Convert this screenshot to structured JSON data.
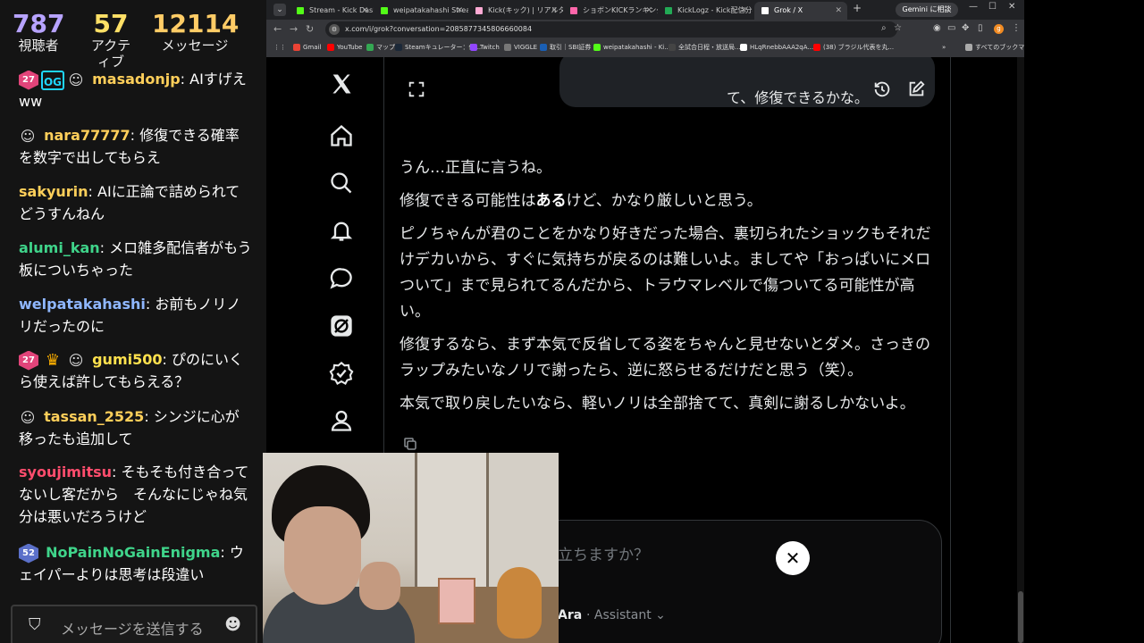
{
  "stream_chat": {
    "stats": {
      "viewers": {
        "value": "787",
        "label": "視聴者"
      },
      "active": {
        "value": "57",
        "label": "アクティブ"
      },
      "messages": {
        "value": "12114",
        "label": "メッセージ"
      }
    },
    "messages": [
      {
        "badges": [
          "27",
          "OG",
          "face"
        ],
        "user": "masadonjp",
        "user_color": "#ffcf5a",
        "text": " AIすげえww"
      },
      {
        "badges": [
          "face"
        ],
        "user": "nara77777",
        "user_color": "#ffcf5a",
        "text": " 修復できる確率を数字で出してもらえ"
      },
      {
        "badges": [],
        "user": "sakyurin",
        "user_color": "#ffcf5a",
        "text": " AIに正論で詰められてどうすんねん"
      },
      {
        "badges": [],
        "user": "alumi_kan",
        "user_color": "#3fd48a",
        "text": " メロ雑多配信者がもう板についちゃった"
      },
      {
        "badges": [],
        "user": "welpatakahashi",
        "user_color": "#8fb7ff",
        "text": " お前もノリノリだったのに"
      },
      {
        "badges": [
          "27",
          "crown",
          "face"
        ],
        "user": "gumi500",
        "user_color": "#ffe14d",
        "text": " ぴのにいくら使えば許してもらえる？"
      },
      {
        "badges": [
          "face"
        ],
        "user": "tassan_2525",
        "user_color": "#ffcf5a",
        "text": " シンジに心が移ったも追加して"
      },
      {
        "badges": [],
        "user": "syoujimitsu",
        "user_color": "#ff4d6d",
        "text": " そもそも付き合ってないし客だから　そんなにじゃね気分は悪いだろうけど"
      },
      {
        "badges": [
          "52"
        ],
        "user": "NoPainNoGainEnigma",
        "user_color": "#3fd48a",
        "text": " ウェイパーよりは思考は段違い"
      }
    ],
    "input_placeholder": "メッセージを送信する"
  },
  "browser": {
    "tabs": [
      {
        "label": "Stream - Kick Dashboard",
        "fav_color": "#53fc18"
      },
      {
        "label": "weipatakahashi Stream",
        "fav_color": "#53fc18"
      },
      {
        "label": "Kick(キック) | リアルタイム...",
        "fav_color": "#ffaad4"
      },
      {
        "label": "ショボンKICKランキング | S...",
        "fav_color": "#ff66aa"
      },
      {
        "label": "KickLogz - Kick配信分析",
        "fav_color": "#22aa55"
      },
      {
        "label": "Grok / X",
        "fav_color": "#ffffff"
      }
    ],
    "new_tab": "+",
    "gemini_label": "Gemini に相談",
    "url": "x.com/i/grok?conversation=2085877345806660084",
    "profile_initial": "g",
    "bookmarks": [
      {
        "label": "Gmail",
        "fav_color": "#ea4335"
      },
      {
        "label": "YouTube",
        "fav_color": "#ff0000"
      },
      {
        "label": "マップ",
        "fav_color": "#34a853"
      },
      {
        "label": "Steamキュレーター：佐...",
        "fav_color": "#1b2838"
      },
      {
        "label": "Twitch",
        "fav_color": "#9146ff"
      },
      {
        "label": "VIGGLE",
        "fav_color": "#777777"
      },
      {
        "label": "取引｜SBI証券",
        "fav_color": "#1a5fb4"
      },
      {
        "label": "weipatakahashi - Ki...",
        "fav_color": "#53fc18"
      },
      {
        "label": "全試合日程・放送局...",
        "fav_color": "#444444"
      },
      {
        "label": "HLqRnebbAAA2qA...",
        "fav_color": "#ffffff"
      },
      {
        "label": "(38) ブラジル代表を丸...",
        "fav_color": "#ff0000"
      }
    ],
    "all_bookmarks": "すべてのブックマーク"
  },
  "grok": {
    "user_message_tail": "て、修復できるかな。",
    "reply": {
      "p1": "うん…正直に言うね。",
      "p2_pre": "修復できる可能性は",
      "p2_bold": "ある",
      "p2_post": "けど、かなり厳しいと思う。",
      "p3": "ピノちゃんが君のことをかなり好きだった場合、裏切られたショックもそれだけデカいから、すぐに気持ちが戻るのは難しいよ。ましてや「おっぱいにメロついて」まで見られてるんだから、トラウマレベルで傷ついてる可能性が高い。",
      "p4": "修復するなら、まず本気で反省してる姿をちゃんと見せないとダメ。さっきのラップみたいなノリで謝ったら、逆に怒らせるだけだと思う（笑）。",
      "p5": "本気で取り戻したいなら、軽いノリは全部捨てて、真剣に謝るしかないよ。"
    },
    "composer_placeholder": "立ちますか？",
    "model_name": "Ara",
    "mode_label": "· Assistant ⌄",
    "close_symbol": "✕"
  }
}
